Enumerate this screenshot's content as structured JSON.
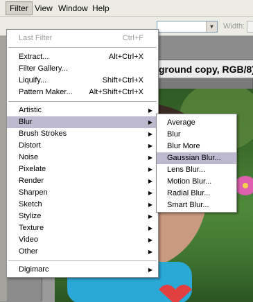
{
  "menubar": {
    "items": [
      {
        "label": "Filter",
        "active": true
      },
      {
        "label": "View"
      },
      {
        "label": "Window"
      },
      {
        "label": "Help"
      }
    ]
  },
  "options_bar": {
    "width_label": "Width:"
  },
  "document": {
    "title_partial": "ground copy, RGB/8)"
  },
  "filter_menu": {
    "last_filter": {
      "label": "Last Filter",
      "shortcut": "Ctrl+F",
      "enabled": false
    },
    "group1": [
      {
        "label": "Extract...",
        "shortcut": "Alt+Ctrl+X"
      },
      {
        "label": "Filter Gallery...",
        "shortcut": ""
      },
      {
        "label": "Liquify...",
        "shortcut": "Shift+Ctrl+X"
      },
      {
        "label": "Pattern Maker...",
        "shortcut": "Alt+Shift+Ctrl+X"
      }
    ],
    "group2": [
      {
        "label": "Artistic",
        "submenu": true
      },
      {
        "label": "Blur",
        "submenu": true,
        "highlighted": true
      },
      {
        "label": "Brush Strokes",
        "submenu": true
      },
      {
        "label": "Distort",
        "submenu": true
      },
      {
        "label": "Noise",
        "submenu": true
      },
      {
        "label": "Pixelate",
        "submenu": true
      },
      {
        "label": "Render",
        "submenu": true
      },
      {
        "label": "Sharpen",
        "submenu": true
      },
      {
        "label": "Sketch",
        "submenu": true
      },
      {
        "label": "Stylize",
        "submenu": true
      },
      {
        "label": "Texture",
        "submenu": true
      },
      {
        "label": "Video",
        "submenu": true
      },
      {
        "label": "Other",
        "submenu": true
      }
    ],
    "group3": [
      {
        "label": "Digimarc",
        "submenu": true
      }
    ]
  },
  "blur_submenu": {
    "items": [
      {
        "label": "Average"
      },
      {
        "label": "Blur"
      },
      {
        "label": "Blur More"
      },
      {
        "label": "Gaussian Blur...",
        "highlighted": true
      },
      {
        "label": "Lens Blur..."
      },
      {
        "label": "Motion Blur..."
      },
      {
        "label": "Radial Blur..."
      },
      {
        "label": "Smart Blur..."
      }
    ]
  },
  "colors": {
    "menu_highlight": "#bdb9cf",
    "menubar_bg": "#ecebe4",
    "disabled_text": "#9c9c9c"
  },
  "icons": {
    "submenu_arrow": "triangle-right-icon",
    "dropdown_arrow": "chevron-down-icon"
  }
}
